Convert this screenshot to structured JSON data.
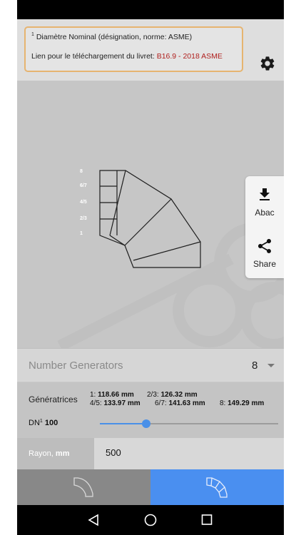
{
  "info": {
    "superscript": "1",
    "line1": "Diamètre Nominal (désignation, norme: ASME)",
    "line2_prefix": "Lien pour le téléchargement du livret: ",
    "line2_link": "B16.9 - 2018 ASME"
  },
  "toolbar": {
    "settings_icon": "gear-icon"
  },
  "drawing": {
    "generator_labels": [
      "8",
      "6/7",
      "4/5",
      "2/3",
      "1"
    ]
  },
  "side_panel": {
    "abac_label": "Abac",
    "abac_icon": "download-icon",
    "share_label": "Share",
    "share_icon": "share-icon"
  },
  "generators": {
    "label": "Number Generators",
    "value": "8"
  },
  "results": {
    "title": "Génératrices",
    "items": [
      {
        "key": "1:",
        "value": "118.66 mm"
      },
      {
        "key": "2/3:",
        "value": "126.32 mm"
      },
      {
        "key": "4/5:",
        "value": "133.97 mm"
      },
      {
        "key": "6/7:",
        "value": "141.63 mm"
      },
      {
        "key": "8:",
        "value": "149.29 mm"
      }
    ],
    "dn_label": "DN",
    "dn_superscript": "1",
    "dn_value": "100",
    "dn_slider_fraction": 0.26
  },
  "rayon": {
    "label": "Rayon, ",
    "unit": "mm",
    "value": "500"
  },
  "tabs": {
    "simple_icon": "elbow-simple-icon",
    "segmented_icon": "elbow-segmented-icon",
    "active": "segmented"
  },
  "navbar": {
    "back_icon": "back-triangle-icon",
    "home_icon": "home-circle-icon",
    "recents_icon": "recents-square-icon"
  },
  "colors": {
    "accent": "#4a8ff0",
    "link": "#b0211f",
    "info_border": "#e6b470"
  }
}
